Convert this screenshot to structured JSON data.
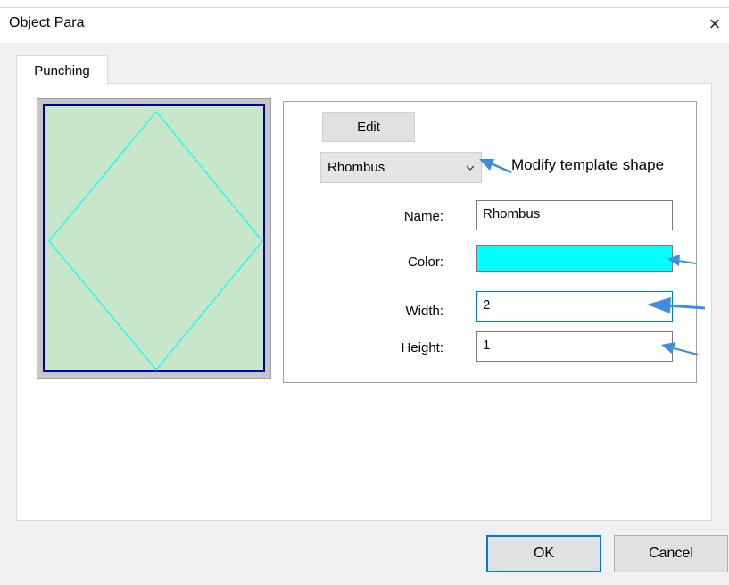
{
  "window": {
    "title": "Object Para",
    "close_glyph": "×"
  },
  "tabs": [
    {
      "label": "Punching",
      "selected": true
    }
  ],
  "preview": {
    "shape": "rhombus",
    "shape_color": "#00ffff",
    "background_color": "#c8e6c9",
    "frame_color": "#0000aa"
  },
  "editor": {
    "edit_label": "Edit",
    "shape_select": {
      "value": "Rhombus",
      "chevron_icon": "chevron-down-icon"
    },
    "annotation": "Modify template shape",
    "fields": {
      "name": {
        "label": "Name:",
        "value": "Rhombus"
      },
      "color": {
        "label": "Color:",
        "value": "#00ffff"
      },
      "width": {
        "label": "Width:",
        "value": "2"
      },
      "height": {
        "label": "Height:",
        "value": "1"
      }
    },
    "annotation_arrow_color": "#3d8ee0"
  },
  "footer": {
    "ok_label": "OK",
    "cancel_label": "Cancel"
  }
}
